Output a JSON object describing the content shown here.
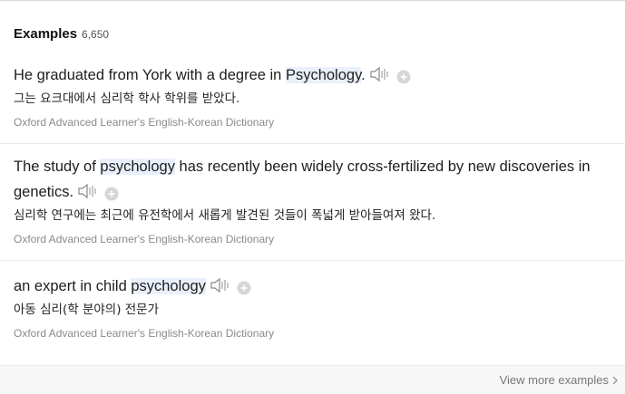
{
  "section": {
    "title": "Examples",
    "count": "6,650"
  },
  "examples": [
    {
      "before": "He graduated from York with a degree in ",
      "keyword": "Psychology",
      "after": ".",
      "translation": "그는 요크대에서 심리학 학사 학위를 받았다.",
      "source": "Oxford Advanced Learner's English-Korean Dictionary"
    },
    {
      "before": "The study of ",
      "keyword": "psychology",
      "after": " has recently been widely cross-fertilized by new discoveries in genetics.",
      "translation": "심리학 연구에는 최근에 유전학에서 새롭게 발견된 것들이 폭넓게 받아들여져 왔다.",
      "source": "Oxford Advanced Learner's English-Korean Dictionary"
    },
    {
      "before": "an expert in child ",
      "keyword": "psychology",
      "after": "",
      "translation": "아동 심리(학 분야의) 전문가",
      "source": "Oxford Advanced Learner's English-Korean Dictionary"
    }
  ],
  "footer": {
    "view_more_label": "View more examples"
  },
  "icons": {
    "audio": "speaker-icon",
    "add": "plus-circle-icon",
    "more": "chevron-right-icon"
  },
  "colors": {
    "highlight": "#eaf0fb",
    "source_text": "#8a8a8a"
  }
}
